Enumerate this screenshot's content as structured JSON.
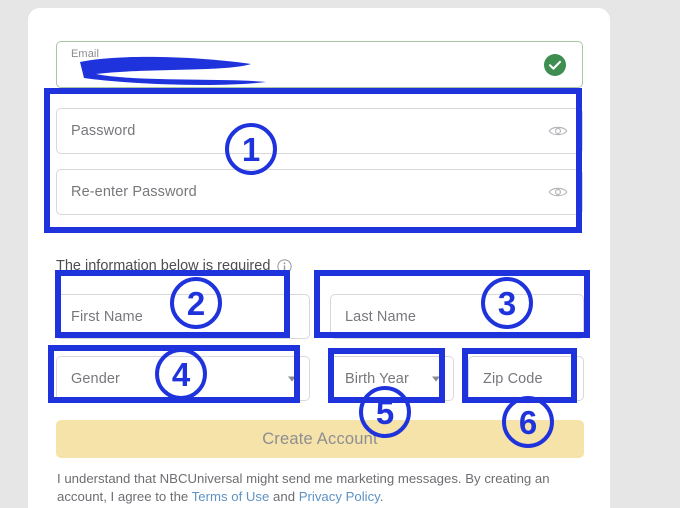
{
  "page": {
    "background_color": "#e6e6e6",
    "card_background": "#ffffff"
  },
  "form": {
    "email": {
      "label": "Email",
      "status_icon": "green-check-icon",
      "status_color": "#3e8e52",
      "redacted": true
    },
    "password": {
      "placeholder": "Password",
      "toggle_icon": "eye-icon"
    },
    "repassword": {
      "placeholder": "Re-enter Password",
      "toggle_icon": "eye-icon"
    },
    "required_note": {
      "text": "The information below is required",
      "icon": "info-icon"
    },
    "first_name": {
      "placeholder": "First Name"
    },
    "last_name": {
      "placeholder": "Last Name"
    },
    "gender": {
      "placeholder": "Gender",
      "icon": "chevron-down-icon"
    },
    "birth_year": {
      "placeholder": "Birth Year",
      "icon": "chevron-down-icon"
    },
    "zip_code": {
      "placeholder": "Zip Code"
    },
    "submit": {
      "label": "Create Account",
      "color": "#f6e3a9",
      "state": "disabled"
    }
  },
  "legal": {
    "line1": "I understand that NBCUniversal might send me marketing messages. By creating an account,",
    "line2_prefix": "I agree to the ",
    "terms_link": "Terms of Use",
    "conjunction": " and ",
    "privacy_link": "Privacy Policy",
    "suffix": "."
  },
  "annotations": {
    "color": "#1f33dd",
    "markers": [
      {
        "number": "1",
        "target": "password-fields-group"
      },
      {
        "number": "2",
        "target": "first-name-field"
      },
      {
        "number": "3",
        "target": "last-name-field"
      },
      {
        "number": "4",
        "target": "gender-field"
      },
      {
        "number": "5",
        "target": "birth-year-field"
      },
      {
        "number": "6",
        "target": "zip-code-field"
      }
    ]
  }
}
